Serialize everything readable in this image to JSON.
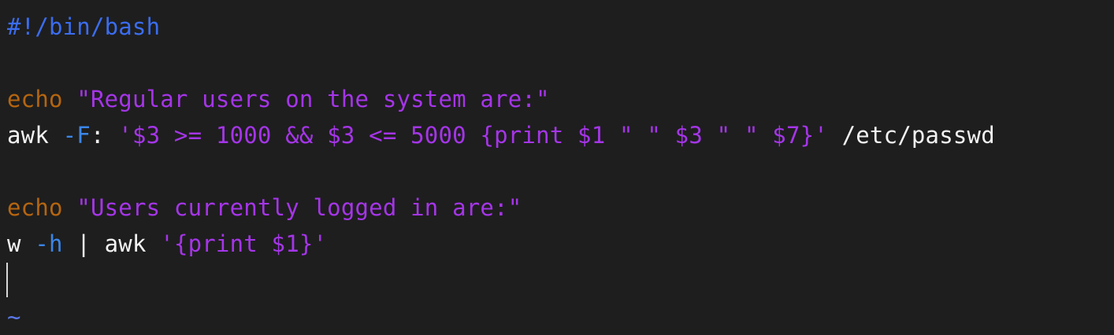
{
  "colors": {
    "background": "#1e1e1e",
    "shebang": "#3b6df0",
    "keyword": "#b5650f",
    "string": "#a535e8",
    "flag": "#3b86e8",
    "plain": "#f2f2f2",
    "tilde": "#5a78e6"
  },
  "lines": [
    {
      "tokens": [
        {
          "text": "#!/bin/bash",
          "kind": "shebang"
        }
      ]
    },
    {
      "tokens": [
        {
          "text": "echo",
          "kind": "keyword"
        },
        {
          "text": " ",
          "kind": "plain"
        },
        {
          "text": "\"Regular users on the system are:\"",
          "kind": "string"
        }
      ]
    },
    {
      "tokens": [
        {
          "text": "awk ",
          "kind": "plain"
        },
        {
          "text": "-F",
          "kind": "flag"
        },
        {
          "text": ": ",
          "kind": "plain"
        },
        {
          "text": "'$3 >= 1000 && $3 <= 5000 {print $1 \" \" $3 \" \" $7}'",
          "kind": "string"
        },
        {
          "text": " /etc/passwd",
          "kind": "plain"
        }
      ]
    },
    {
      "tokens": [
        {
          "text": "echo",
          "kind": "keyword"
        },
        {
          "text": " ",
          "kind": "plain"
        },
        {
          "text": "\"Users currently logged in are:\"",
          "kind": "string"
        }
      ]
    },
    {
      "tokens": [
        {
          "text": "w ",
          "kind": "plain"
        },
        {
          "text": "-h",
          "kind": "flag"
        },
        {
          "text": " | awk ",
          "kind": "plain"
        },
        {
          "text": "'{print $1}'",
          "kind": "string"
        }
      ]
    }
  ],
  "empty_line_marker": "~"
}
